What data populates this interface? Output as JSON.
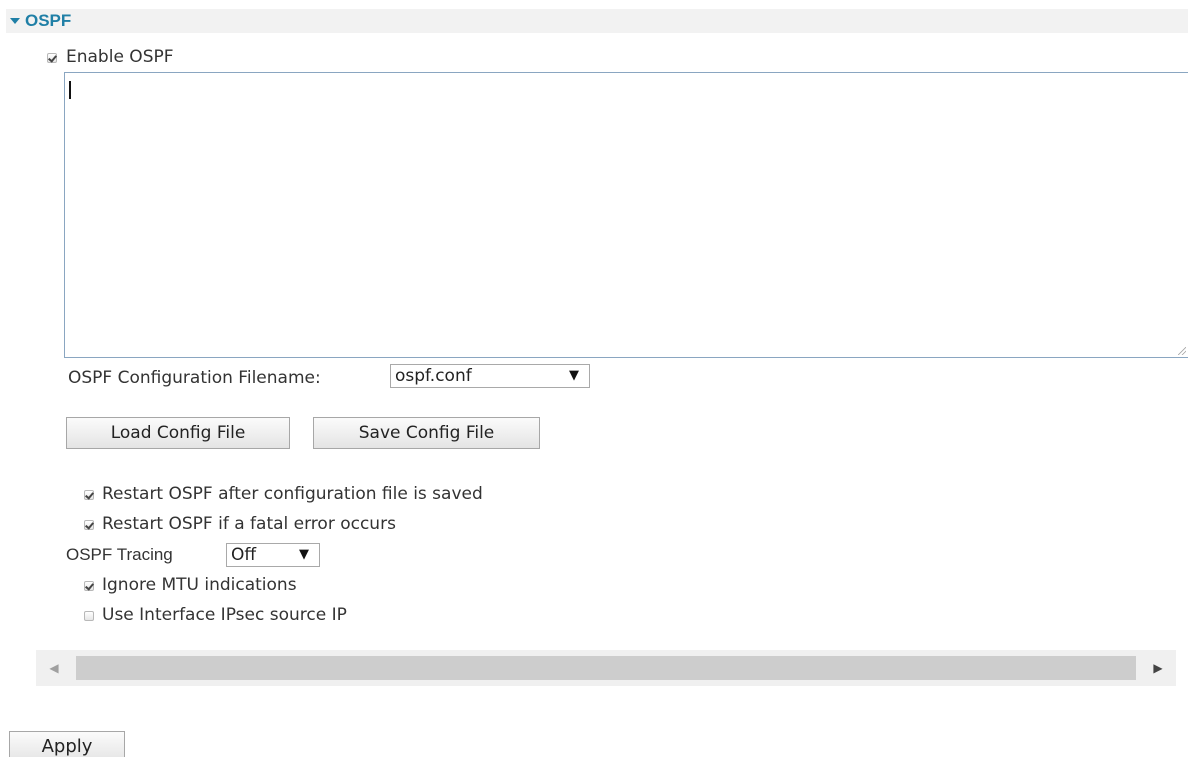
{
  "section": {
    "title": "OSPF"
  },
  "enable_ospf": {
    "label": "Enable OSPF",
    "checked": true
  },
  "config_textarea": {
    "value": ""
  },
  "config_filename": {
    "label": "OSPF Configuration Filename:",
    "selected": "ospf.conf",
    "arrow": "▼"
  },
  "buttons": {
    "load": "Load Config File",
    "save": "Save Config File",
    "apply": "Apply"
  },
  "options": {
    "restart_after_save": {
      "label": "Restart OSPF after configuration file is saved",
      "checked": true
    },
    "restart_on_fatal": {
      "label": "Restart OSPF if a fatal error occurs",
      "checked": true
    },
    "ignore_mtu": {
      "label": "Ignore MTU indications",
      "checked": true
    },
    "use_ipsec_source_ip": {
      "label": "Use Interface IPsec source IP",
      "checked": false
    }
  },
  "tracing": {
    "label": "OSPF Tracing",
    "selected": "Off",
    "arrow": "▼"
  },
  "scrollbar": {
    "left_arrow": "◀",
    "right_arrow": "▶"
  },
  "icons": {
    "section_toggle": "caret-down-icon"
  },
  "colors": {
    "section_title": "#1f7fa6",
    "section_bg": "#f2f2f2",
    "textarea_border": "#8aa6c1"
  }
}
